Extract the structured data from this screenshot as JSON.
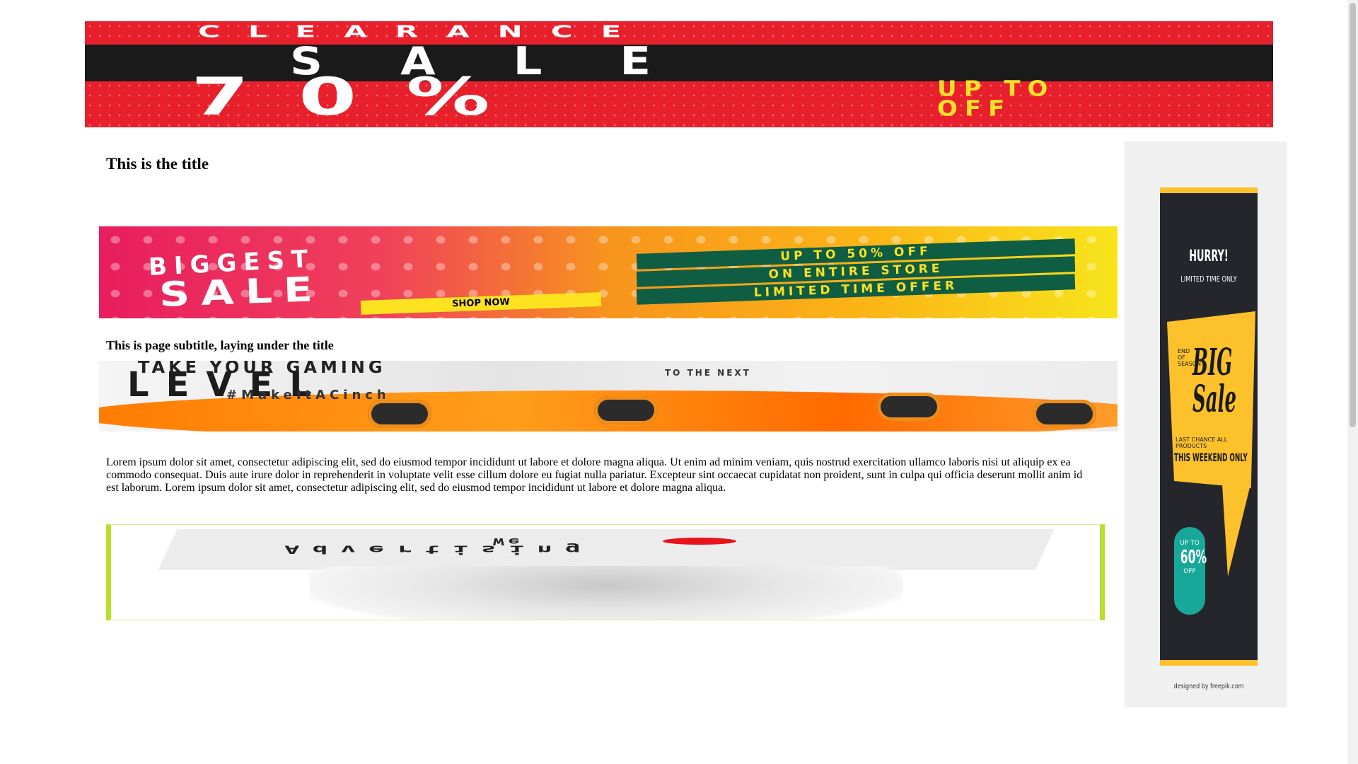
{
  "top_banner": {
    "line1": "CLEARANCE",
    "line2": "SALE",
    "line3": "70%",
    "line4a": "UP TO",
    "line4b": "OFF",
    "colors": {
      "background": "#e8202c",
      "band": "#1a1a1a",
      "accent": "#f7e02a"
    }
  },
  "main": {
    "title": "This is the title",
    "subtitle": "This is page subtitle, laying under the title",
    "body_text": "Lorem ipsum dolor sit amet, consectetur adipiscing elit, sed do eiusmod tempor incididunt ut labore et dolore magna aliqua. Ut enim ad minim veniam, quis nostrud exercitation ullamco laboris nisi ut aliquip ex ea commodo consequat. Duis aute irure dolor in reprehenderit in voluptate velit esse cillum dolore eu fugiat nulla pariatur. Excepteur sint occaecat cupidatat non proident, sunt in culpa qui officia deserunt mollit anim id est laborum. Lorem ipsum dolor sit amet, consectetur adipiscing elit, sed do eiusmod tempor incididunt ut labore et dolore magna aliqua."
  },
  "sale_banner": {
    "line1": "BIGGEST",
    "line2": "SALE",
    "cta": "SHOP NOW",
    "offer1": "UP TO 50% OFF",
    "offer2": "ON ENTIRE STORE",
    "offer3": "LIMITED TIME OFFER"
  },
  "gaming_banner": {
    "line1": "TAKE YOUR GAMING",
    "line2": "LEVEL",
    "line3": "TO THE NEXT",
    "hashtag": "#MakeItACinch"
  },
  "ad_banner": {
    "line1": "We",
    "line2": "Advertising",
    "heart_color": "#e8121b",
    "border_color": "#b7e02b"
  },
  "sidebar_ad": {
    "hurry": "HURRY!",
    "limited": "LIMITED TIME ONLY",
    "end_season": "END OF SEASON",
    "big_sale": "BIG Sale",
    "last_chance": "LAST CHANCE   ALL PRODUCTS",
    "weekend": "THIS WEEKEND ONLY",
    "badge_upto": "UP TO",
    "badge_pct": "60%",
    "badge_off": "OFF",
    "designed_by": "designed by freepik.com",
    "colors": {
      "dark": "#25262c",
      "yellow": "#fcc12b",
      "teal": "#17a89a"
    }
  }
}
